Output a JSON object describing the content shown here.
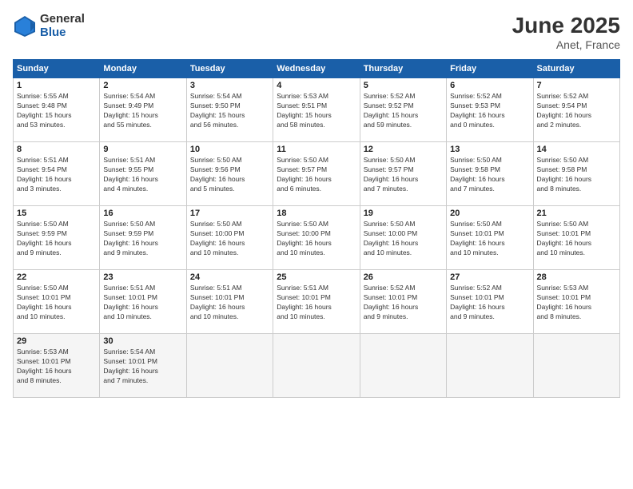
{
  "logo": {
    "general": "General",
    "blue": "Blue"
  },
  "title": "June 2025",
  "subtitle": "Anet, France",
  "days_header": [
    "Sunday",
    "Monday",
    "Tuesday",
    "Wednesday",
    "Thursday",
    "Friday",
    "Saturday"
  ],
  "weeks": [
    [
      {
        "day": "1",
        "info": "Sunrise: 5:55 AM\nSunset: 9:48 PM\nDaylight: 15 hours\nand 53 minutes."
      },
      {
        "day": "2",
        "info": "Sunrise: 5:54 AM\nSunset: 9:49 PM\nDaylight: 15 hours\nand 55 minutes."
      },
      {
        "day": "3",
        "info": "Sunrise: 5:54 AM\nSunset: 9:50 PM\nDaylight: 15 hours\nand 56 minutes."
      },
      {
        "day": "4",
        "info": "Sunrise: 5:53 AM\nSunset: 9:51 PM\nDaylight: 15 hours\nand 58 minutes."
      },
      {
        "day": "5",
        "info": "Sunrise: 5:52 AM\nSunset: 9:52 PM\nDaylight: 15 hours\nand 59 minutes."
      },
      {
        "day": "6",
        "info": "Sunrise: 5:52 AM\nSunset: 9:53 PM\nDaylight: 16 hours\nand 0 minutes."
      },
      {
        "day": "7",
        "info": "Sunrise: 5:52 AM\nSunset: 9:54 PM\nDaylight: 16 hours\nand 2 minutes."
      }
    ],
    [
      {
        "day": "8",
        "info": "Sunrise: 5:51 AM\nSunset: 9:54 PM\nDaylight: 16 hours\nand 3 minutes."
      },
      {
        "day": "9",
        "info": "Sunrise: 5:51 AM\nSunset: 9:55 PM\nDaylight: 16 hours\nand 4 minutes."
      },
      {
        "day": "10",
        "info": "Sunrise: 5:50 AM\nSunset: 9:56 PM\nDaylight: 16 hours\nand 5 minutes."
      },
      {
        "day": "11",
        "info": "Sunrise: 5:50 AM\nSunset: 9:57 PM\nDaylight: 16 hours\nand 6 minutes."
      },
      {
        "day": "12",
        "info": "Sunrise: 5:50 AM\nSunset: 9:57 PM\nDaylight: 16 hours\nand 7 minutes."
      },
      {
        "day": "13",
        "info": "Sunrise: 5:50 AM\nSunset: 9:58 PM\nDaylight: 16 hours\nand 7 minutes."
      },
      {
        "day": "14",
        "info": "Sunrise: 5:50 AM\nSunset: 9:58 PM\nDaylight: 16 hours\nand 8 minutes."
      }
    ],
    [
      {
        "day": "15",
        "info": "Sunrise: 5:50 AM\nSunset: 9:59 PM\nDaylight: 16 hours\nand 9 minutes."
      },
      {
        "day": "16",
        "info": "Sunrise: 5:50 AM\nSunset: 9:59 PM\nDaylight: 16 hours\nand 9 minutes."
      },
      {
        "day": "17",
        "info": "Sunrise: 5:50 AM\nSunset: 10:00 PM\nDaylight: 16 hours\nand 10 minutes."
      },
      {
        "day": "18",
        "info": "Sunrise: 5:50 AM\nSunset: 10:00 PM\nDaylight: 16 hours\nand 10 minutes."
      },
      {
        "day": "19",
        "info": "Sunrise: 5:50 AM\nSunset: 10:00 PM\nDaylight: 16 hours\nand 10 minutes."
      },
      {
        "day": "20",
        "info": "Sunrise: 5:50 AM\nSunset: 10:01 PM\nDaylight: 16 hours\nand 10 minutes."
      },
      {
        "day": "21",
        "info": "Sunrise: 5:50 AM\nSunset: 10:01 PM\nDaylight: 16 hours\nand 10 minutes."
      }
    ],
    [
      {
        "day": "22",
        "info": "Sunrise: 5:50 AM\nSunset: 10:01 PM\nDaylight: 16 hours\nand 10 minutes."
      },
      {
        "day": "23",
        "info": "Sunrise: 5:51 AM\nSunset: 10:01 PM\nDaylight: 16 hours\nand 10 minutes."
      },
      {
        "day": "24",
        "info": "Sunrise: 5:51 AM\nSunset: 10:01 PM\nDaylight: 16 hours\nand 10 minutes."
      },
      {
        "day": "25",
        "info": "Sunrise: 5:51 AM\nSunset: 10:01 PM\nDaylight: 16 hours\nand 10 minutes."
      },
      {
        "day": "26",
        "info": "Sunrise: 5:52 AM\nSunset: 10:01 PM\nDaylight: 16 hours\nand 9 minutes."
      },
      {
        "day": "27",
        "info": "Sunrise: 5:52 AM\nSunset: 10:01 PM\nDaylight: 16 hours\nand 9 minutes."
      },
      {
        "day": "28",
        "info": "Sunrise: 5:53 AM\nSunset: 10:01 PM\nDaylight: 16 hours\nand 8 minutes."
      }
    ],
    [
      {
        "day": "29",
        "info": "Sunrise: 5:53 AM\nSunset: 10:01 PM\nDaylight: 16 hours\nand 8 minutes."
      },
      {
        "day": "30",
        "info": "Sunrise: 5:54 AM\nSunset: 10:01 PM\nDaylight: 16 hours\nand 7 minutes."
      },
      {
        "day": "",
        "info": ""
      },
      {
        "day": "",
        "info": ""
      },
      {
        "day": "",
        "info": ""
      },
      {
        "day": "",
        "info": ""
      },
      {
        "day": "",
        "info": ""
      }
    ]
  ]
}
